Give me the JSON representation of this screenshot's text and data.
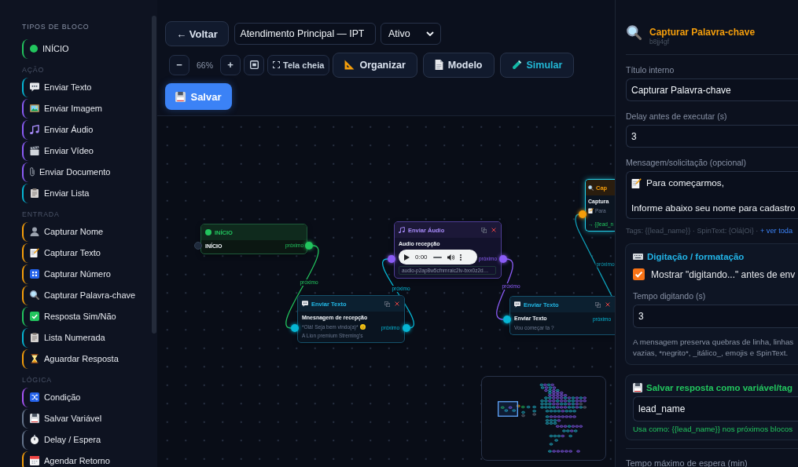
{
  "sidebar": {
    "title": "TIPOS DE BLOCO",
    "sections": [
      {
        "items": [
          {
            "kind": "start",
            "label": "INÍCIO",
            "color": "#22c55e"
          }
        ]
      },
      {
        "title": "AÇÃO",
        "items": [
          {
            "kind": "text",
            "label": "Enviar Texto",
            "color": "#06b6d4"
          },
          {
            "kind": "image",
            "label": "Enviar Imagem",
            "color": "#8b5cf6"
          },
          {
            "kind": "audio",
            "label": "Enviar Áudio",
            "color": "#8b5cf6"
          },
          {
            "kind": "video",
            "label": "Enviar Vídeo",
            "color": "#8b5cf6"
          },
          {
            "kind": "document",
            "label": "Enviar Documento",
            "color": "#8b5cf6"
          },
          {
            "kind": "list",
            "label": "Enviar Lista",
            "color": "#06b6d4"
          }
        ]
      },
      {
        "title": "ENTRADA",
        "items": [
          {
            "kind": "name",
            "label": "Capturar Nome",
            "color": "#f59e0b"
          },
          {
            "kind": "text_input",
            "label": "Capturar Texto",
            "color": "#f59e0b"
          },
          {
            "kind": "number",
            "label": "Capturar Número",
            "color": "#f59e0b"
          },
          {
            "kind": "keyword",
            "label": "Capturar Palavra-chave",
            "color": "#f59e0b"
          },
          {
            "kind": "yes_no",
            "label": "Resposta Sim/Não",
            "color": "#22c55e"
          },
          {
            "kind": "numbered_list",
            "label": "Lista Numerada",
            "color": "#06b6d4"
          },
          {
            "kind": "wait",
            "label": "Aguardar Resposta",
            "color": "#f59e0b"
          }
        ]
      },
      {
        "title": "LÓGICA",
        "items": [
          {
            "kind": "condition",
            "label": "Condição",
            "color": "#a855f7"
          },
          {
            "kind": "variable",
            "label": "Salvar Variável",
            "color": "#64748b"
          },
          {
            "kind": "delay",
            "label": "Delay / Espera",
            "color": "#64748b"
          },
          {
            "kind": "schedule",
            "label": "Agendar Retorno",
            "color": "#f59e0b"
          }
        ]
      }
    ]
  },
  "toolbar": {
    "back": "← Voltar",
    "flow_name": "Atendimento Principal — IPT",
    "status": "Ativo",
    "zoom_out": "−",
    "zoom_level": "66%",
    "zoom_in": "+",
    "fullscreen": "Tela cheia",
    "actions": [
      {
        "kind": "organize",
        "label": "Organizar"
      },
      {
        "kind": "template",
        "label": "Modelo"
      },
      {
        "kind": "simulate",
        "label": "Simular"
      }
    ],
    "save": "Salvar"
  },
  "canvas": {
    "nodes": [
      {
        "kind": "start",
        "color": "#22c55e",
        "title": "INÍCIO",
        "heading": "INÍCIO",
        "output": "próximo",
        "selected": false
      },
      {
        "kind": "text",
        "color": "#06b6d4",
        "title": "Enviar Texto",
        "heading": "Mnesnagem de recepção",
        "lines": [
          {
            "kind": "smile",
            "text": "*Olá! Seja bem vindo(a)*"
          },
          {
            "kind": "plain",
            "text": "A Lion premium Streming's"
          }
        ],
        "output": "próximo",
        "selected": false
      },
      {
        "kind": "audio",
        "color": "#8b5cf6",
        "title": "Enviar Áudio",
        "heading": "Audio recepção",
        "player": {
          "time": "0:00"
        },
        "file": "audio-p2ap8w5cfnmraic2lv-bxx0z2d…",
        "output": "próximo",
        "selected": false
      },
      {
        "kind": "keyword",
        "color": "#f59e0b",
        "title": "Cap",
        "heading": "Captura",
        "lines": [
          {
            "kind": "memo",
            "text": "Para"
          }
        ],
        "variable": "→ {{lead_n",
        "selected": true
      },
      {
        "kind": "text",
        "color": "#06b6d4",
        "title": "Enviar Texto",
        "heading": "Enviar Texto",
        "lines": [
          {
            "kind": "plain",
            "text": "Vou começar ta ?"
          }
        ],
        "output": "próximo",
        "selected": false
      }
    ],
    "edges": [
      {
        "label": "próximo",
        "color": "#22c55e"
      },
      {
        "label": "próximo",
        "color": "#06b6d4"
      },
      {
        "label": "próximo",
        "color": "#8b5cf6"
      },
      {
        "label": "próximo",
        "color": "#0e9fb8"
      }
    ]
  },
  "inspector": {
    "kind": "keyword",
    "title": "Capturar Palavra-chave",
    "id": "b8jj4gf",
    "fields": [
      {
        "label": "Título interno",
        "value": "Capturar Palavra-chave"
      },
      {
        "label": "Delay antes de executar (s)",
        "value": "3"
      }
    ],
    "message": {
      "label": "Mensagem/solicitação (opcional)",
      "paragraphs": [
        {
          "kind": "memo",
          "text": "Para começarmos,"
        },
        {
          "kind": "plain",
          "text": "Informe abaixo seu nome para cadastro"
        }
      ]
    },
    "tags_hint": "Tags: {{lead_name}} · SpinText: {Olá|Oi} ·",
    "tags_link": "+ ver toda",
    "typing": {
      "title": "Digitação / formatação",
      "checkbox_label": "Mostrar \"digitando...\" antes de env",
      "checked": true,
      "field_label": "Tempo digitando (s)",
      "field_value": "3",
      "note": "A mensagem preserva quebras de linha, linhas vazias, *negrito*, _itálico_, emojis e SpinText."
    },
    "variable": {
      "title": "Salvar resposta como variável/tag",
      "value": "lead_name",
      "hint": "Usa como: {{lead_name}} nos próximos blocos"
    },
    "next_label": "Tempo máximo de espera (min)"
  }
}
